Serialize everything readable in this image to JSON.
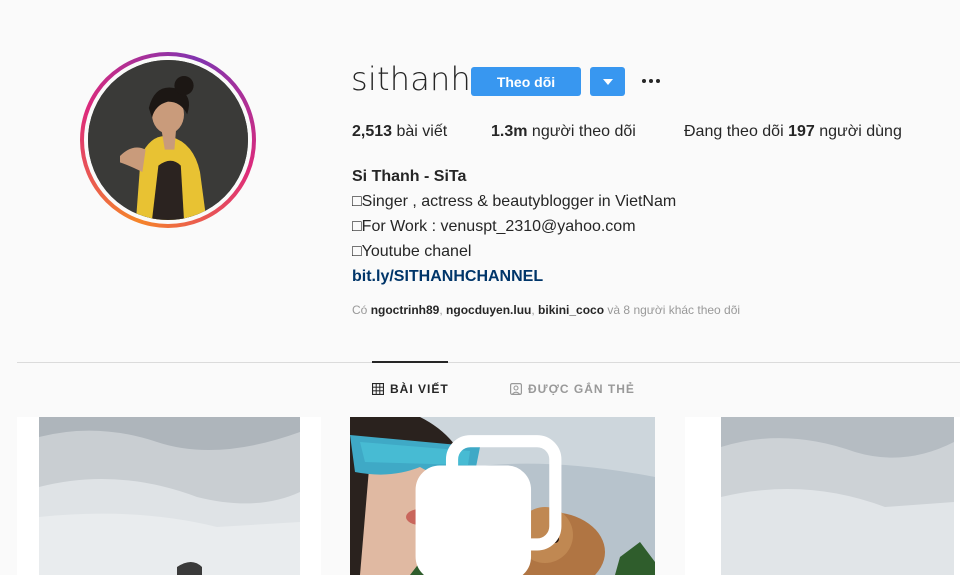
{
  "profile": {
    "username": "sithanh",
    "follow_label": "Theo dõi",
    "stats": {
      "posts_value": "2,513",
      "posts_label": "bài viết",
      "followers_value": "1.3m",
      "followers_label": "người theo dõi",
      "following_prefix": "Đang theo dõi",
      "following_value": "197",
      "following_suffix": "người dùng"
    },
    "bio": {
      "name": "Si Thanh - SiTa",
      "line1": "Singer , actress & beautyblogger in VietNam",
      "line2": "For Work : venuspt_2310@yahoo.com",
      "line3": "Youtube chanel",
      "link": "bit.ly/SITHANHCHANNEL"
    },
    "followed_by": {
      "prefix": "Có",
      "user1": "ngoctrinh89",
      "user2": "ngocduyen.luu",
      "user3": "bikini_coco",
      "suffix": "và 8 người khác theo dõi"
    }
  },
  "tabs": {
    "posts": "BÀI VIẾT",
    "tagged": "ĐƯỢC GẮN THẺ"
  },
  "colors": {
    "accent": "#3897f0",
    "link": "#003569",
    "muted": "#999999"
  },
  "icons": {
    "more": "ellipsis-icon",
    "dropdown": "chevron-down-icon",
    "grid": "grid-icon",
    "tagged": "tag-icon",
    "multi": "carousel-icon"
  }
}
